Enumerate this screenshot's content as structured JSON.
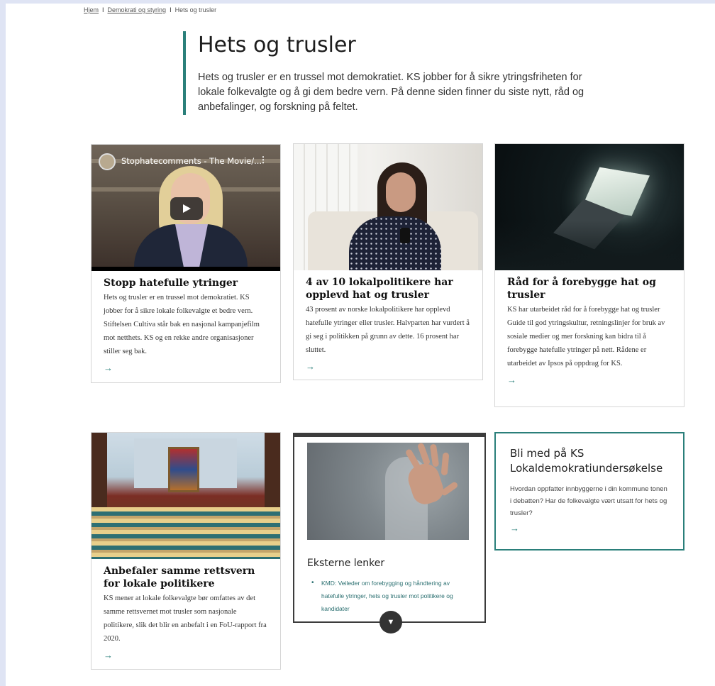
{
  "breadcrumb": {
    "items": [
      "Hjem",
      "Demokrati og styring"
    ],
    "separator": "I",
    "current": "Hets og trusler"
  },
  "intro": {
    "title": "Hets og trusler",
    "text": "Hets og trusler er en trussel mot demokratiet. KS jobber for å sikre ytringsfriheten for lokale folkevalgte og å gi dem bedre vern. På denne siden finner du siste nytt, råd og anbefalinger, og forskning på feltet."
  },
  "cards": [
    {
      "video_title": "Stophatecomments - The Movie/...",
      "title": "Stopp hatefulle ytringer",
      "text": "Hets og trusler er en trussel mot demokratiet. KS jobber for å sikre lokale folkevalgte et bedre vern. Stiftelsen Cultiva står bak en nasjonal kampanjefilm mot netthets. KS og en rekke andre organisasjoner stiller seg bak.",
      "arrow": "→"
    },
    {
      "title": "4 av 10 lokalpolitikere har opplevd hat og trusler",
      "text": "43 prosent av norske lokalpolitikere har opplevd hatefulle ytringer eller trusler. Halvparten har vurdert å gi seg i politikken på grunn av dette. 16 prosent har sluttet.",
      "arrow": "→"
    },
    {
      "title": "Råd for å forebygge hat og trusler",
      "text": "KS har utarbeidet råd for å forebygge hat og trusler Guide til god ytringskultur, retningslinjer for bruk av sosiale medier og mer forskning kan bidra til å forebygge hatefulle ytringer på nett. Rådene er utarbeidet av Ipsos på oppdrag for KS.",
      "arrow": "→"
    },
    {
      "title": "Anbefaler samme rettsvern for lokale politikere",
      "text": "KS mener at lokale folkevalgte bør omfattes av det samme rettsvernet mot trusler som nasjonale politikere, slik det blir en anbefalt i en FoU-rapport fra 2020.",
      "arrow": "→"
    }
  ],
  "external": {
    "title": "Eksterne lenker",
    "links": [
      "KMD: Veileder om forebygging og håndtering av hatefulle ytringer, hets og trusler mot politikere og kandidater"
    ],
    "scroll_icon": "▼"
  },
  "join": {
    "title": "Bli med på KS Lokaldemokratiundersøkelse",
    "text": "Hvordan oppfatter innbyggerne i din kommune tonen i debatten? Har de folkevalgte vært utsatt for hets og trusler?",
    "arrow": "→"
  },
  "colors": {
    "accent": "#2a7f7a",
    "page_background": "#dfe4f4"
  }
}
